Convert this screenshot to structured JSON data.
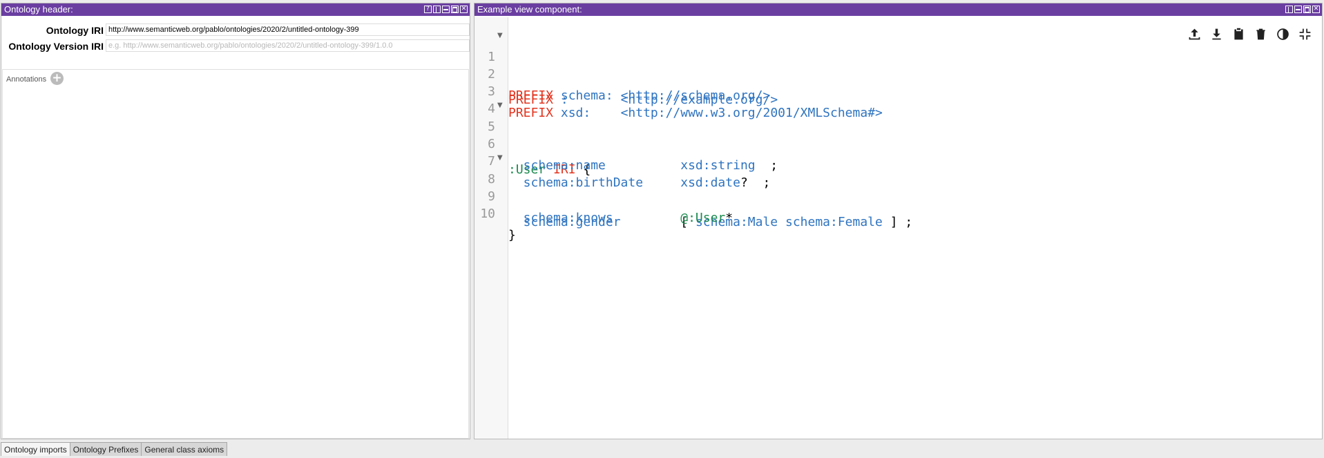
{
  "left_panel": {
    "title": "Ontology header:",
    "ontology_iri_label": "Ontology IRI",
    "ontology_iri_value": "http://www.semanticweb.org/pablo/ontologies/2020/2/untitled-ontology-399",
    "version_iri_label": "Ontology Version IRI",
    "version_iri_placeholder": "e.g. http://www.semanticweb.org/pablo/ontologies/2020/2/untitled-ontology-399/1.0.0",
    "annotations_label": "Annotations"
  },
  "right_panel": {
    "title": "Example view component:"
  },
  "editor": {
    "line_numbers": [
      "1",
      "2",
      "3",
      "4",
      "5",
      "6",
      "7",
      "8",
      "9",
      "10"
    ],
    "l1": {
      "kw": "PREFIX",
      "pfx": " :       ",
      "uri": "<http://example.org/>"
    },
    "l2": {
      "kw": "PREFIX",
      "pfx": " schema: ",
      "uri": "<http://schema.org/>"
    },
    "l3": {
      "kw": "PREFIX",
      "pfx": " xsd:    ",
      "uri": "<http://www.w3.org/2001/XMLSchema#>"
    },
    "l5": {
      "shape": ":User",
      "kw": " IRI",
      "pn": " {"
    },
    "l6": {
      "prop": "  schema:name          ",
      "val": "xsd:string",
      "pn": "  ;"
    },
    "l7": {
      "prop": "  schema:birthDate     ",
      "val": "xsd:date",
      "pn": "?  ;"
    },
    "l8": {
      "prop": "  schema:gender        ",
      "pn1": "[ ",
      "val": "schema:Male schema:Female",
      "pn2": " ] ;"
    },
    "l9": {
      "prop": "  schema:knows         ",
      "shape": "@:User",
      "pn": "*"
    },
    "l10": {
      "pn": "}"
    }
  },
  "toolbar_icons": [
    "upload-icon",
    "download-icon",
    "clipboard-icon",
    "trash-icon",
    "contrast-icon",
    "collapse-icon"
  ],
  "bottom_tabs": [
    "Ontology imports",
    "Ontology Prefixes",
    "General class axioms"
  ],
  "colors": {
    "titlebar": "#6a3ea1",
    "keyword": "#e3341f",
    "iri": "#2f74c0",
    "shape": "#1b8a4e"
  }
}
